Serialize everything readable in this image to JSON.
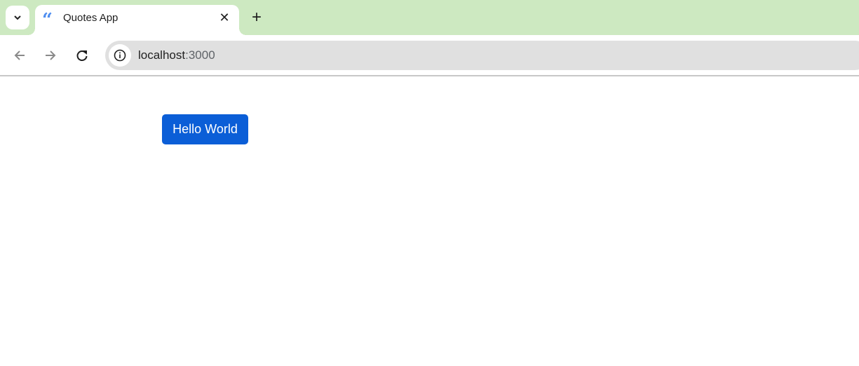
{
  "browser": {
    "tab": {
      "title": "Quotes App",
      "favicon": "quote-icon",
      "favicon_glyph": "“",
      "close_glyph": "✕"
    },
    "new_tab_glyph": "+",
    "address": {
      "host": "localhost",
      "port": ":3000"
    },
    "colors": {
      "tabstrip": "#cde9c1",
      "omnibox": "#e0e0e0"
    }
  },
  "page": {
    "button_label": "Hello World",
    "button_color": "#0b5ed7"
  }
}
